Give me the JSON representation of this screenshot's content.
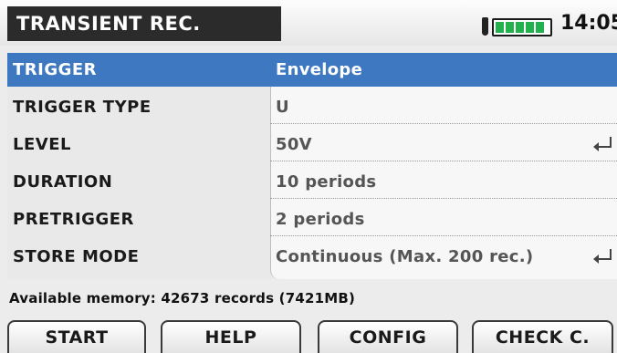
{
  "title": "TRANSIENT REC.",
  "status": {
    "clock": "14:05",
    "battery_icon": "battery-full-icon",
    "plug_icon": "plug-icon",
    "battery_level": 1.0
  },
  "settings": [
    {
      "label": "TRIGGER",
      "value": "Envelope",
      "selected": true,
      "enter": false
    },
    {
      "label": "TRIGGER TYPE",
      "value": "U",
      "selected": false,
      "enter": false
    },
    {
      "label": "LEVEL",
      "value": "50V",
      "selected": false,
      "enter": true
    },
    {
      "label": "DURATION",
      "value": "10 periods",
      "selected": false,
      "enter": false
    },
    {
      "label": "PRETRIGGER",
      "value": "2 periods",
      "selected": false,
      "enter": false
    },
    {
      "label": "STORE MODE",
      "value": "Continuous (Max. 200 rec.)",
      "selected": false,
      "enter": true
    }
  ],
  "memory_text": "Available memory: 42673 records (7421MB)",
  "function_keys": [
    "START",
    "HELP",
    "CONFIG",
    "CHECK C."
  ],
  "colors": {
    "selection": "#3d78c0",
    "battery": "#22b14c",
    "title_bg": "#2b2b2b"
  }
}
